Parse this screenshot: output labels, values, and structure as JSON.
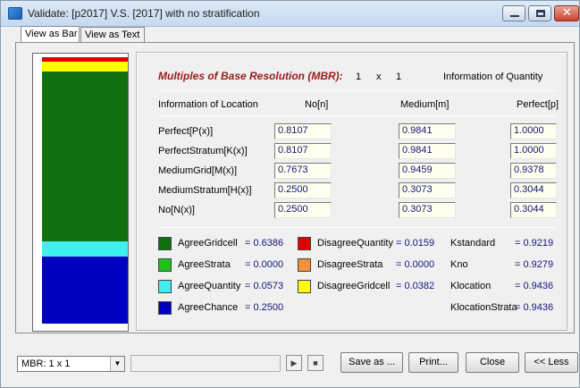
{
  "window": {
    "title": "Validate: [p2017]  V.S.  [2017] with no stratification"
  },
  "tabs": [
    "View as Bar",
    "View as Text"
  ],
  "bar_segments": [
    {
      "name": "DisagreeQuantity",
      "fraction": 0.0159,
      "color": "#e00000"
    },
    {
      "name": "DisagreeGridcell",
      "fraction": 0.0382,
      "color": "#ffff00"
    },
    {
      "name": "AgreeGridcell",
      "fraction": 0.6386,
      "color": "#107010"
    },
    {
      "name": "AgreeQuantity",
      "fraction": 0.0573,
      "color": "#40f0f0"
    },
    {
      "name": "AgreeChance",
      "fraction": 0.25,
      "color": "#0000c0"
    }
  ],
  "mbr": {
    "title": "Multiples of Base Resolution (MBR):",
    "x": "1",
    "sep": "x",
    "y": "1"
  },
  "headers": {
    "quantity": "Information of Quantity",
    "location": "Information of Location",
    "no": "No[n]",
    "medium": "Medium[m]",
    "perfect": "Perfect[p]"
  },
  "rows": [
    {
      "label": "Perfect[P(x)]",
      "no": "0.8107",
      "medium": "0.9841",
      "perfect": "1.0000"
    },
    {
      "label": "PerfectStratum[K(x)]",
      "no": "0.8107",
      "medium": "0.9841",
      "perfect": "1.0000"
    },
    {
      "label": "MediumGrid[M(x)]",
      "no": "0.7673",
      "medium": "0.9459",
      "perfect": "0.9378"
    },
    {
      "label": "MediumStratum[H(x)]",
      "no": "0.2500",
      "medium": "0.3073",
      "perfect": "0.3044"
    },
    {
      "label": "No[N(x)]",
      "no": "0.2500",
      "medium": "0.3073",
      "perfect": "0.3044"
    }
  ],
  "legend": [
    {
      "label": "AgreeGridcell",
      "value": "= 0.6386",
      "color": "#107010"
    },
    {
      "label": "AgreeStrata",
      "value": "= 0.0000",
      "color": "#20c020"
    },
    {
      "label": "AgreeQuantity",
      "value": "= 0.0573",
      "color": "#40f0f0"
    },
    {
      "label": "AgreeChance",
      "value": "= 0.2500",
      "color": "#0000c0"
    },
    {
      "label": "DisagreeQuantity",
      "value": "= 0.0159",
      "color": "#e00000"
    },
    {
      "label": "DisagreeStrata",
      "value": "= 0.0000",
      "color": "#f09040"
    },
    {
      "label": "DisagreeGridcell",
      "value": "= 0.0382",
      "color": "#ffff00"
    }
  ],
  "kappas": [
    {
      "label": "Kstandard",
      "value": "= 0.9219"
    },
    {
      "label": "Kno",
      "value": "= 0.9279"
    },
    {
      "label": "Klocation",
      "value": "= 0.9436"
    },
    {
      "label": "KlocationStrata",
      "value": "= 0.9436"
    }
  ],
  "bottom": {
    "mbr_select": "MBR: 1 x 1",
    "save_as": "Save as ...",
    "print": "Print...",
    "close": "Close",
    "less": "<< Less"
  }
}
